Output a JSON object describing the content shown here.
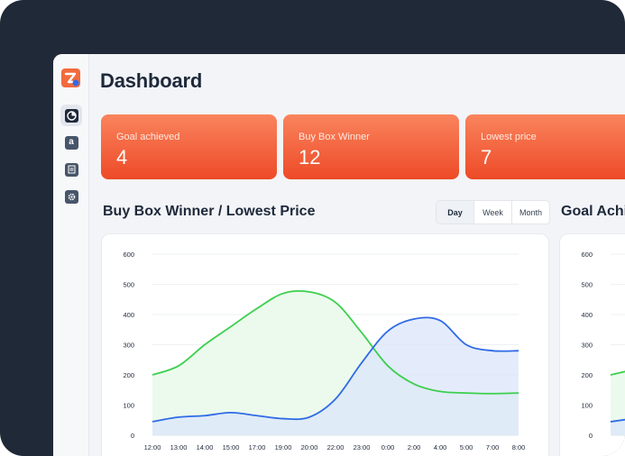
{
  "page": {
    "title": "Dashboard"
  },
  "sidebar": {
    "items": [
      {
        "icon": "pie-chart-icon",
        "active": true
      },
      {
        "icon": "amazon-icon",
        "label": "a"
      },
      {
        "icon": "document-icon"
      },
      {
        "icon": "gear-icon"
      }
    ]
  },
  "kpis": [
    {
      "label": "Goal achieved",
      "value": "4"
    },
    {
      "label": "Buy Box Winner",
      "value": "12"
    },
    {
      "label": "Lowest price",
      "value": "7"
    }
  ],
  "sections": {
    "buybox_title": "Buy Box Winner / Lowest Price",
    "goal_title": "Goal Achi"
  },
  "range_tabs": [
    {
      "label": "Day",
      "active": true
    },
    {
      "label": "Week",
      "active": false
    },
    {
      "label": "Month",
      "active": false
    }
  ],
  "colors": {
    "accent_start": "#f9845d",
    "accent_end": "#ee4a27",
    "green_series": "#3ccf4e",
    "blue_series": "#2f6be6",
    "green_fill": "#e9f9ea",
    "blue_fill": "#dbe6fb",
    "overlap_fill": "#d5e7e6"
  },
  "chart_data": [
    {
      "type": "area",
      "title": "Buy Box Winner / Lowest Price",
      "categories": [
        "12:00",
        "13:00",
        "14:00",
        "15:00",
        "17:00",
        "19:00",
        "20:00",
        "22:00",
        "23:00",
        "0:00",
        "2:00",
        "4:00",
        "5:00",
        "7:00",
        "8:00"
      ],
      "ylim": [
        0,
        600
      ],
      "yticks": [
        "600",
        "500",
        "400",
        "300",
        "200",
        "100",
        "0"
      ],
      "grid": true,
      "legend": "none",
      "series": [
        {
          "color": "green",
          "values": [
            200,
            230,
            300,
            360,
            420,
            470,
            475,
            440,
            340,
            230,
            170,
            145,
            140,
            138,
            140
          ]
        },
        {
          "color": "blue",
          "values": [
            45,
            60,
            65,
            75,
            65,
            55,
            60,
            120,
            240,
            345,
            385,
            380,
            300,
            280,
            280
          ]
        }
      ]
    },
    {
      "type": "area",
      "title": "Goal Achi",
      "ylim": [
        0,
        600
      ],
      "yticks": [
        "600",
        "500",
        "400",
        "300",
        "200",
        "100",
        "0"
      ],
      "grid": true,
      "legend": "none",
      "series": [
        {
          "color": "green",
          "values": [
            200,
            225
          ]
        },
        {
          "color": "blue",
          "values": [
            45,
            60
          ]
        }
      ]
    }
  ]
}
